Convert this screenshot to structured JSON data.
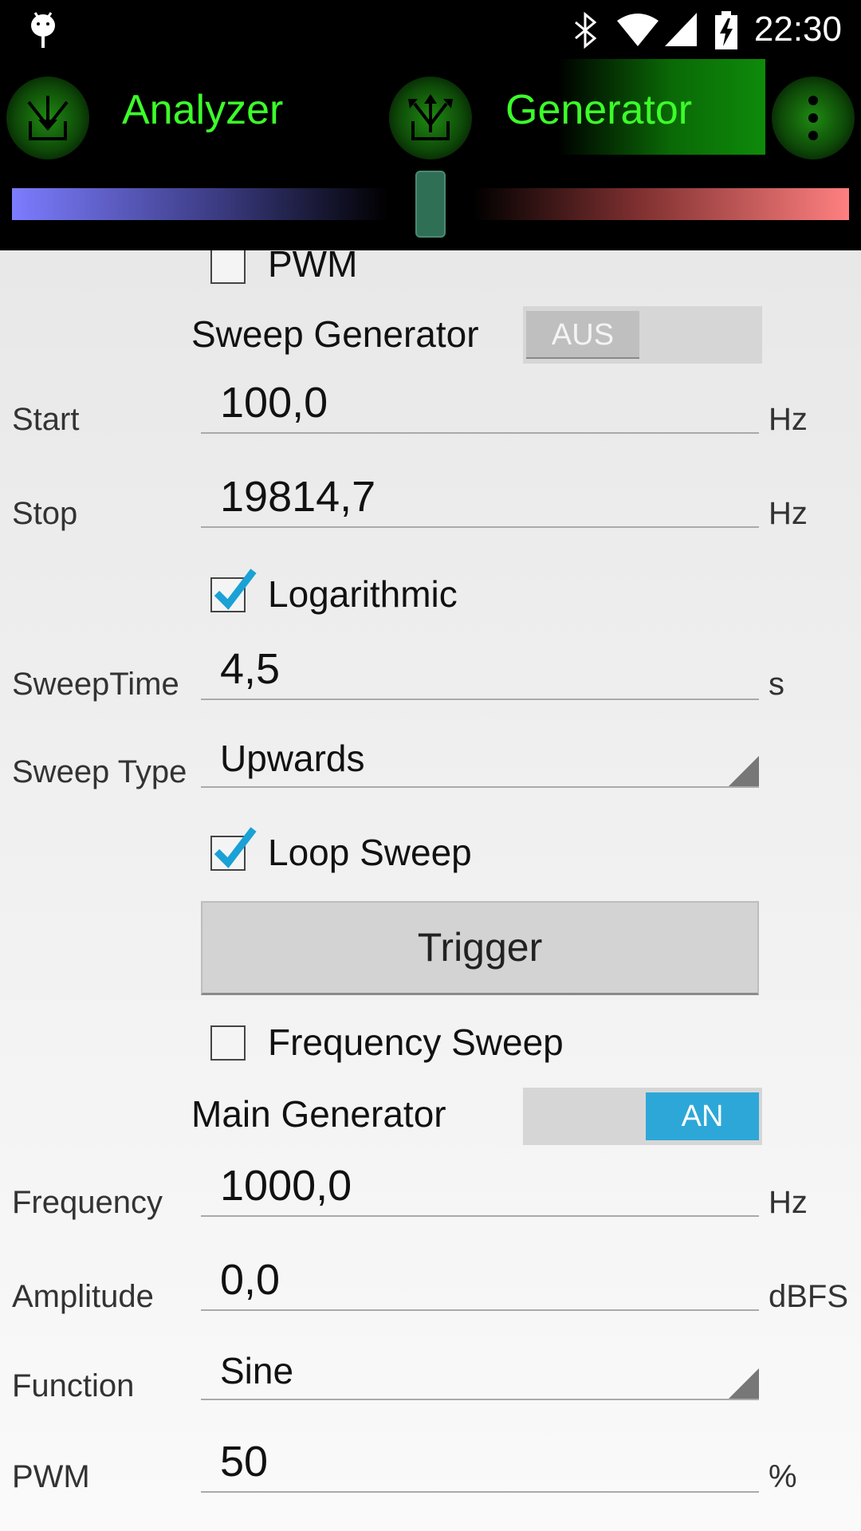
{
  "status": {
    "time": "22:30"
  },
  "tabs": {
    "analyzer": "Analyzer",
    "generator": "Generator"
  },
  "balance_slider": {
    "value": 0.5
  },
  "pwm_top": {
    "label": "PWM",
    "checked": false
  },
  "sweep_generator": {
    "label": "Sweep Generator",
    "switch_text": "AUS",
    "on": false
  },
  "start": {
    "label": "Start",
    "value": "100,0",
    "unit": "Hz"
  },
  "stop": {
    "label": "Stop",
    "value": "19814,7",
    "unit": "Hz"
  },
  "logarithmic": {
    "label": "Logarithmic",
    "checked": true
  },
  "sweep_time": {
    "label": "SweepTime",
    "value": "4,5",
    "unit": "s"
  },
  "sweep_type": {
    "label": "Sweep Type",
    "value": "Upwards"
  },
  "loop_sweep": {
    "label": "Loop Sweep",
    "checked": true
  },
  "trigger": {
    "label": "Trigger"
  },
  "frequency_sweep": {
    "label": "Frequency Sweep",
    "checked": false
  },
  "main_generator": {
    "label": "Main Generator",
    "switch_text": "AN",
    "on": true
  },
  "frequency": {
    "label": "Frequency",
    "value": "1000,0",
    "unit": "Hz"
  },
  "amplitude": {
    "label": "Amplitude",
    "value": "0,0",
    "unit": "dBFS"
  },
  "function": {
    "label": "Function",
    "value": "Sine"
  },
  "pwm": {
    "label": "PWM",
    "value": "50",
    "unit": "%"
  },
  "colors": {
    "accent_green": "#3cff2a",
    "switch_on": "#2da7d8",
    "check_blue": "#1aa1d6"
  }
}
